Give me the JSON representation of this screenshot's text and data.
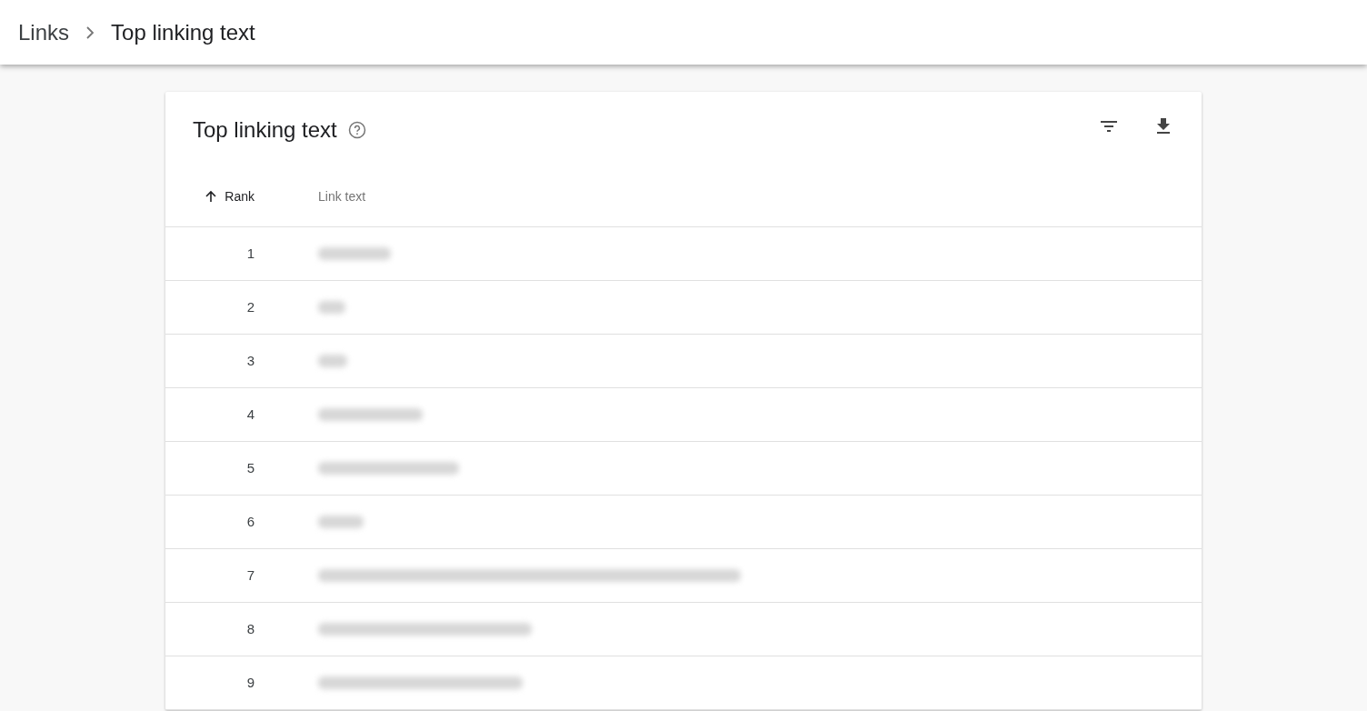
{
  "breadcrumb": [
    {
      "label": "Links",
      "current": false
    },
    {
      "label": "Top linking text",
      "current": true
    }
  ],
  "card": {
    "title": "Top linking text"
  },
  "table": {
    "columns": [
      {
        "label": "Rank",
        "sorted": true
      },
      {
        "label": "Link text",
        "sorted": false
      }
    ],
    "rows": [
      {
        "rank": "1"
      },
      {
        "rank": "2"
      },
      {
        "rank": "3"
      },
      {
        "rank": "4"
      },
      {
        "rank": "5"
      },
      {
        "rank": "6"
      },
      {
        "rank": "7"
      },
      {
        "rank": "8"
      },
      {
        "rank": "9"
      }
    ]
  }
}
